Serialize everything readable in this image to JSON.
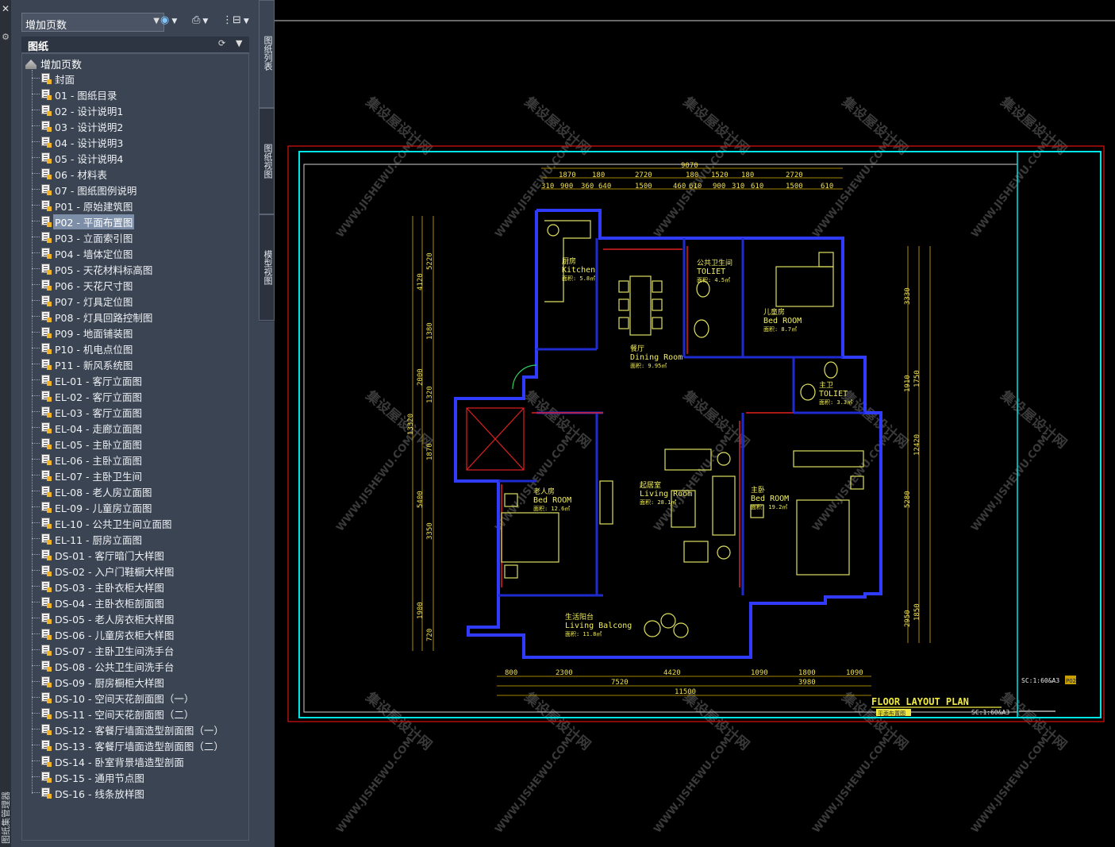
{
  "left_strip": {
    "close_glyph": "✕",
    "settings_glyph": "⚙",
    "vertical_label": "图纸集管理器"
  },
  "toolbar": {
    "sheet_set_combo_value": "增加页数",
    "publish_icon": "publish-icon",
    "print_icon": "printer-icon",
    "options_icon": "sheet-options-icon"
  },
  "panel": {
    "title": "图纸",
    "refresh_icon": "refresh-icon",
    "menu_icon": "chevron-down-icon"
  },
  "tree": {
    "root_label": "增加页数",
    "selected_index": 9,
    "items": [
      "封面",
      "01 - 图纸目录",
      "02 - 设计说明1",
      "03 - 设计说明2",
      "04 - 设计说明3",
      "05 - 设计说明4",
      "06 - 材料表",
      "07 - 图纸图例说明",
      "P01 - 原始建筑图",
      "P02 - 平面布置图",
      "P03 - 立面索引图",
      "P04 - 墙体定位图",
      "P05 - 天花材料标高图",
      "P06 - 天花尺寸图",
      "P07 - 灯具定位图",
      "P08 - 灯具回路控制图",
      "P09 - 地面铺装图",
      "P10 - 机电点位图",
      "P11 - 新风系统图",
      "EL-01 - 客厅立面图",
      "EL-02 - 客厅立面图",
      "EL-03 - 客厅立面图",
      "EL-04 - 走廊立面图",
      "EL-05 - 主卧立面图",
      "EL-06 - 主卧立面图",
      "EL-07 - 主卧卫生间",
      "EL-08 - 老人房立面图",
      "EL-09 - 儿童房立面图",
      "EL-10 - 公共卫生间立面图",
      "EL-11 - 厨房立面图",
      "DS-01 - 客厅暗门大样图",
      "DS-02 - 入户门鞋橱大样图",
      "DS-03 - 主卧衣柜大样图",
      "DS-04 - 主卧衣柜剖面图",
      "DS-05 - 老人房衣柜大样图",
      "DS-06 - 儿童房衣柜大样图",
      "DS-07 - 主卧卫生间洗手台",
      "DS-08 - 公共卫生间洗手台",
      "DS-09 - 厨房橱柜大样图",
      "DS-10 - 空间天花剖面图（一）",
      "DS-11 - 空间天花剖面图（二）",
      "DS-12 - 客餐厅墙面造型剖面图（一）",
      "DS-13 - 客餐厅墙面造型剖面图（二）",
      "DS-14 - 卧室背景墙造型剖面",
      "DS-15 - 通用节点图",
      "DS-16 - 线条放样图"
    ]
  },
  "side_tabs": [
    "图纸列表",
    "图纸视图",
    "模型视图"
  ],
  "drawing": {
    "rooms": [
      {
        "cn": "厨房",
        "en": "Kitchen",
        "area": "面积: 5.8㎡"
      },
      {
        "cn": "公共卫生间",
        "en": "TOLIET",
        "area": "面积: 4.5㎡"
      },
      {
        "cn": "儿童房",
        "en": "Bed ROOM",
        "area": "面积: 8.7㎡"
      },
      {
        "cn": "餐厅",
        "en": "Dining Room",
        "area": "面积: 9.95㎡"
      },
      {
        "cn": "主卫",
        "en": "TOLIET",
        "area": "面积: 3.3㎡"
      },
      {
        "cn": "老人房",
        "en": "Bed ROOM",
        "area": "面积: 12.6㎡"
      },
      {
        "cn": "起居室",
        "en": "Living Room",
        "area": "面积: 28.1㎡"
      },
      {
        "cn": "主卧",
        "en": "Bed ROOM",
        "area": "面积: 19.2㎡"
      },
      {
        "cn": "生活阳台",
        "en": "Living Balcong",
        "area": "面积: 11.8㎡"
      }
    ],
    "top_dims_row1": [
      "1870",
      "180",
      "2720",
      "180",
      "1520",
      "180",
      "2720"
    ],
    "top_dims_row2": [
      "310",
      "900",
      "360",
      "640",
      "1500",
      "460",
      "610",
      "900",
      "310",
      "610",
      "1500",
      "610"
    ],
    "top_total": "9070",
    "bottom_dims_row1": [
      "800",
      "2300",
      "4420",
      "1090",
      "1800",
      "1090"
    ],
    "bottom_dims_row2": [
      "7520",
      "3980"
    ],
    "bottom_total": "11500",
    "left_dims": [
      "5220",
      "4120",
      "1380",
      "2000",
      "1320",
      "13320",
      "1870",
      "5400",
      "3350",
      "1900",
      "720"
    ],
    "right_dims": [
      "3330",
      "1750",
      "1910",
      "12420",
      "5280",
      "1850",
      "2950"
    ],
    "title": "FLOOR   LAYOUT   PLAN",
    "title_cn": "平面布置图",
    "scale": "SC:1:60&A3",
    "scale_small": "SC:1:60&A3",
    "sheet_no": "P02",
    "watermark_cn": "集设屋设计网",
    "watermark_en": "WWW.JISHEWU.COM"
  }
}
